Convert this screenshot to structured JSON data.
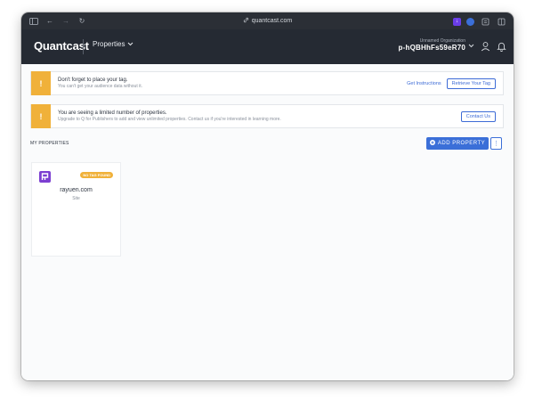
{
  "browser": {
    "url": "quantcast.com"
  },
  "header": {
    "logo": "Quantcast",
    "nav_label": "Properties",
    "org_name": "Unnamed Organization",
    "org_id": "p-hQBHhFs59eR70"
  },
  "banners": [
    {
      "title": "Don't forget to place your tag.",
      "subtitle": "You can't get your audience data without it.",
      "link_label": "Get Instructions",
      "button_label": "Retrieve Your Tag"
    },
    {
      "title": "You are seeing a limited number of properties.",
      "subtitle": "Upgrade to Q for Publishers to add and view unlimited properties. Contact us if you're interested in learning more.",
      "button_label": "Contact Us"
    }
  ],
  "properties_section": {
    "label": "MY PROPERTIES",
    "add_button_label": "ADD PROPERTY"
  },
  "property_card": {
    "badge": "NO TAG FOUND",
    "name": "rayuen.com",
    "type": "Site"
  },
  "colors": {
    "accent": "#3b6fd8",
    "warning": "#f0b13a",
    "header_bg": "#252a33",
    "property_icon": "#7c3fd1"
  }
}
